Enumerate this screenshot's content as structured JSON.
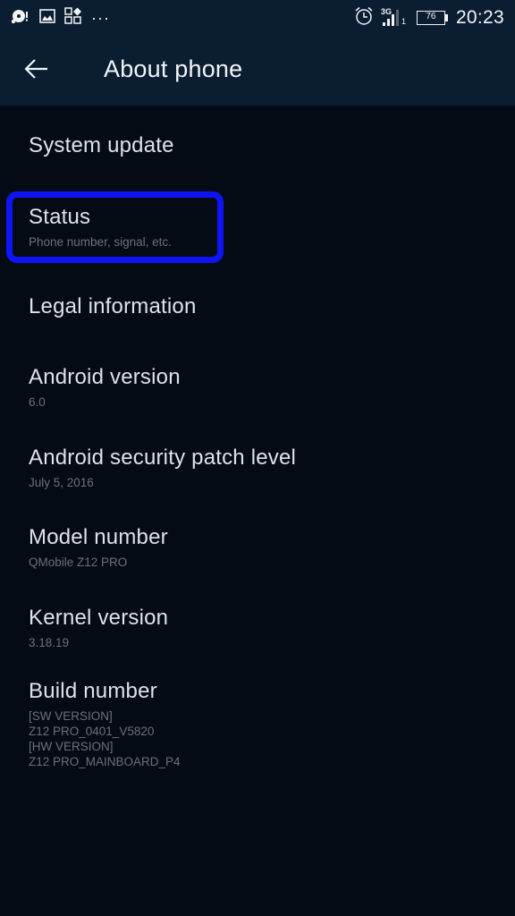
{
  "status_bar": {
    "left_icons": [
      "sync-alert-icon",
      "image-notification-icon",
      "apps-notification-icon",
      "more-notifications-icon"
    ],
    "more_glyph": "···",
    "network_type": "3G",
    "sim_slot": "1",
    "battery_level": "76",
    "battery_percent": 76,
    "time": "20:23"
  },
  "app_bar": {
    "back_icon": "arrow-back-icon",
    "title": "About phone"
  },
  "items": [
    {
      "title": "System update"
    },
    {
      "title": "Status",
      "subtitle": "Phone number, signal, etc."
    },
    {
      "title": "Legal information"
    },
    {
      "title": "Android version",
      "subtitle": "6.0"
    },
    {
      "title": "Android security patch level",
      "subtitle": "July 5, 2016"
    },
    {
      "title": "Model number",
      "subtitle": "QMobile Z12 PRO"
    },
    {
      "title": "Kernel version",
      "subtitle": "3.18.19"
    },
    {
      "title": "Build number",
      "subtitle_lines": [
        "[SW VERSION]",
        "Z12 PRO_0401_V5820",
        "[HW VERSION]",
        "Z12 PRO_MAINBOARD_P4"
      ]
    }
  ],
  "highlight": {
    "target": "Status",
    "color": "#0f14f5"
  },
  "colors": {
    "app_bar": "#0a1d31",
    "background": "#040b15",
    "primary_text": "#dfe2e6",
    "secondary_text": "#6b717a"
  }
}
